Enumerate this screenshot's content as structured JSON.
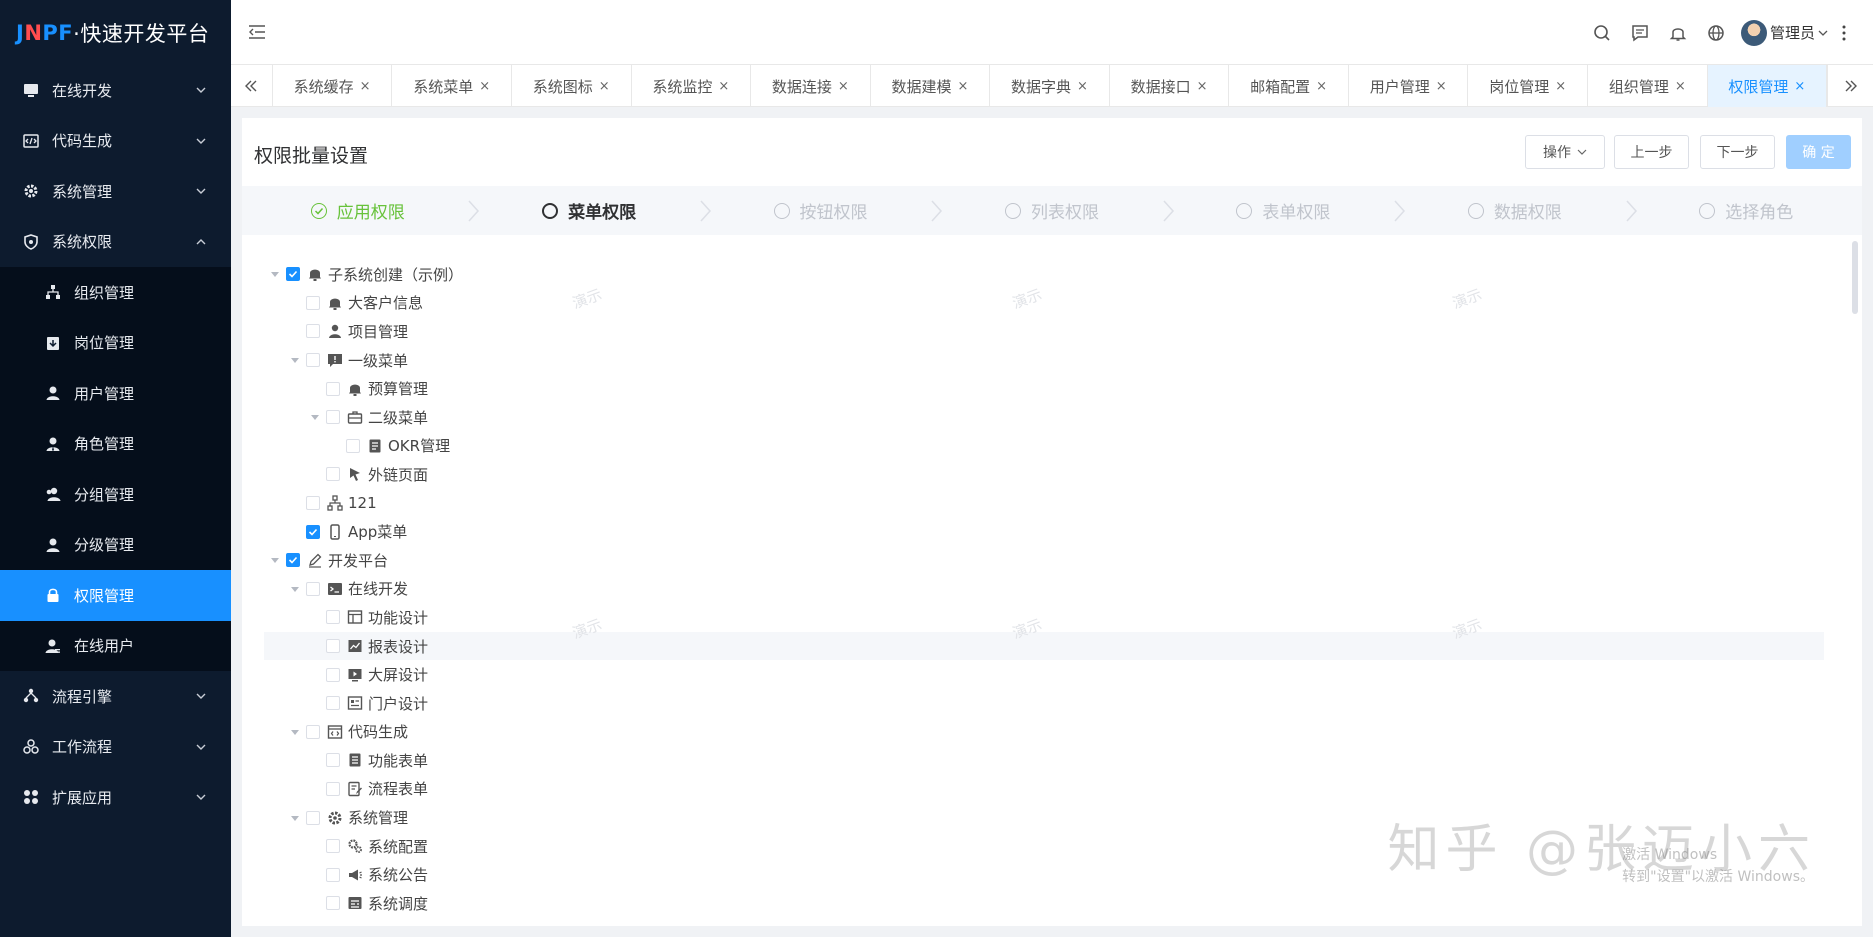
{
  "app": {
    "logo_j": "J",
    "logo_n": "N",
    "logo_pf": "PF",
    "logo_rest": "·快速开发平台"
  },
  "sidebar": {
    "items": [
      {
        "label": "在线开发",
        "icon": "monitor-icon"
      },
      {
        "label": "代码生成",
        "icon": "code-icon"
      },
      {
        "label": "系统管理",
        "icon": "gear-icon"
      },
      {
        "label": "系统权限",
        "icon": "shield-icon"
      }
    ],
    "sub_items": [
      {
        "label": "组织管理",
        "icon": "org-icon"
      },
      {
        "label": "岗位管理",
        "icon": "post-icon"
      },
      {
        "label": "用户管理",
        "icon": "user-icon"
      },
      {
        "label": "角色管理",
        "icon": "role-icon"
      },
      {
        "label": "分组管理",
        "icon": "group-icon"
      },
      {
        "label": "分级管理",
        "icon": "level-icon"
      },
      {
        "label": "权限管理",
        "icon": "lock-icon"
      },
      {
        "label": "在线用户",
        "icon": "online-user-icon"
      }
    ],
    "bottom_items": [
      {
        "label": "流程引擎",
        "icon": "flow-icon"
      },
      {
        "label": "工作流程",
        "icon": "workflow-icon"
      },
      {
        "label": "扩展应用",
        "icon": "apps-icon"
      }
    ]
  },
  "header": {
    "user_name": "管理员"
  },
  "tabs": [
    "系统缓存",
    "系统菜单",
    "系统图标",
    "系统监控",
    "数据连接",
    "数据建模",
    "数据字典",
    "数据接口",
    "邮箱配置",
    "用户管理",
    "岗位管理",
    "组织管理",
    "权限管理"
  ],
  "tab_close": "×",
  "page": {
    "title": "权限批量设置",
    "btn_ops": "操作",
    "btn_prev": "上一步",
    "btn_next": "下一步",
    "btn_ok": "确 定"
  },
  "steps": [
    "应用权限",
    "菜单权限",
    "按钮权限",
    "列表权限",
    "表单权限",
    "数据权限",
    "选择角色"
  ],
  "tree": [
    {
      "label": "子系统创建（示例）",
      "level": 0,
      "caret": true,
      "checked": true,
      "icon": "bell-icon"
    },
    {
      "label": "大客户信息",
      "level": 1,
      "caret": false,
      "checked": false,
      "icon": "bell-icon"
    },
    {
      "label": "项目管理",
      "level": 1,
      "caret": false,
      "checked": false,
      "icon": "person-icon"
    },
    {
      "label": "一级菜单",
      "level": 1,
      "caret": true,
      "checked": false,
      "icon": "chat-alert-icon"
    },
    {
      "label": "预算管理",
      "level": 2,
      "caret": false,
      "checked": false,
      "icon": "bell-icon"
    },
    {
      "label": "二级菜单",
      "level": 2,
      "caret": true,
      "checked": false,
      "icon": "briefcase-icon"
    },
    {
      "label": "OKR管理",
      "level": 3,
      "caret": false,
      "checked": false,
      "icon": "doc-icon"
    },
    {
      "label": "外链页面",
      "level": 2,
      "caret": false,
      "checked": false,
      "icon": "pointer-icon"
    },
    {
      "label": "121",
      "level": 1,
      "caret": false,
      "checked": false,
      "icon": "sitemap-icon"
    },
    {
      "label": "App菜单",
      "level": 1,
      "caret": false,
      "checked": true,
      "icon": "phone-icon"
    },
    {
      "label": "开发平台",
      "level": 0,
      "caret": true,
      "checked": true,
      "icon": "pen-icon"
    },
    {
      "label": "在线开发",
      "level": 1,
      "caret": true,
      "checked": false,
      "icon": "terminal-icon"
    },
    {
      "label": "功能设计",
      "level": 2,
      "caret": false,
      "checked": false,
      "icon": "layout-icon"
    },
    {
      "label": "报表设计",
      "level": 2,
      "caret": false,
      "checked": false,
      "icon": "chart-icon"
    },
    {
      "label": "大屏设计",
      "level": 2,
      "caret": false,
      "checked": false,
      "icon": "screen-icon"
    },
    {
      "label": "门户设计",
      "level": 2,
      "caret": false,
      "checked": false,
      "icon": "portal-icon"
    },
    {
      "label": "代码生成",
      "level": 1,
      "caret": true,
      "checked": false,
      "icon": "code-window-icon"
    },
    {
      "label": "功能表单",
      "level": 2,
      "caret": false,
      "checked": false,
      "icon": "list-icon"
    },
    {
      "label": "流程表单",
      "level": 2,
      "caret": false,
      "checked": false,
      "icon": "edit-form-icon"
    },
    {
      "label": "系统管理",
      "level": 1,
      "caret": true,
      "checked": false,
      "icon": "gear-icon"
    },
    {
      "label": "系统配置",
      "level": 2,
      "caret": false,
      "checked": false,
      "icon": "gears-icon"
    },
    {
      "label": "系统公告",
      "level": 2,
      "caret": false,
      "checked": false,
      "icon": "megaphone-icon"
    },
    {
      "label": "系统调度",
      "level": 2,
      "caret": false,
      "checked": false,
      "icon": "schedule-icon"
    }
  ],
  "watermark_text": "演示",
  "overlay": {
    "zhihu": "知乎 @张迈小六",
    "win1": "激活 Windows",
    "win2": "转到\"设置\"以激活 Windows。"
  }
}
